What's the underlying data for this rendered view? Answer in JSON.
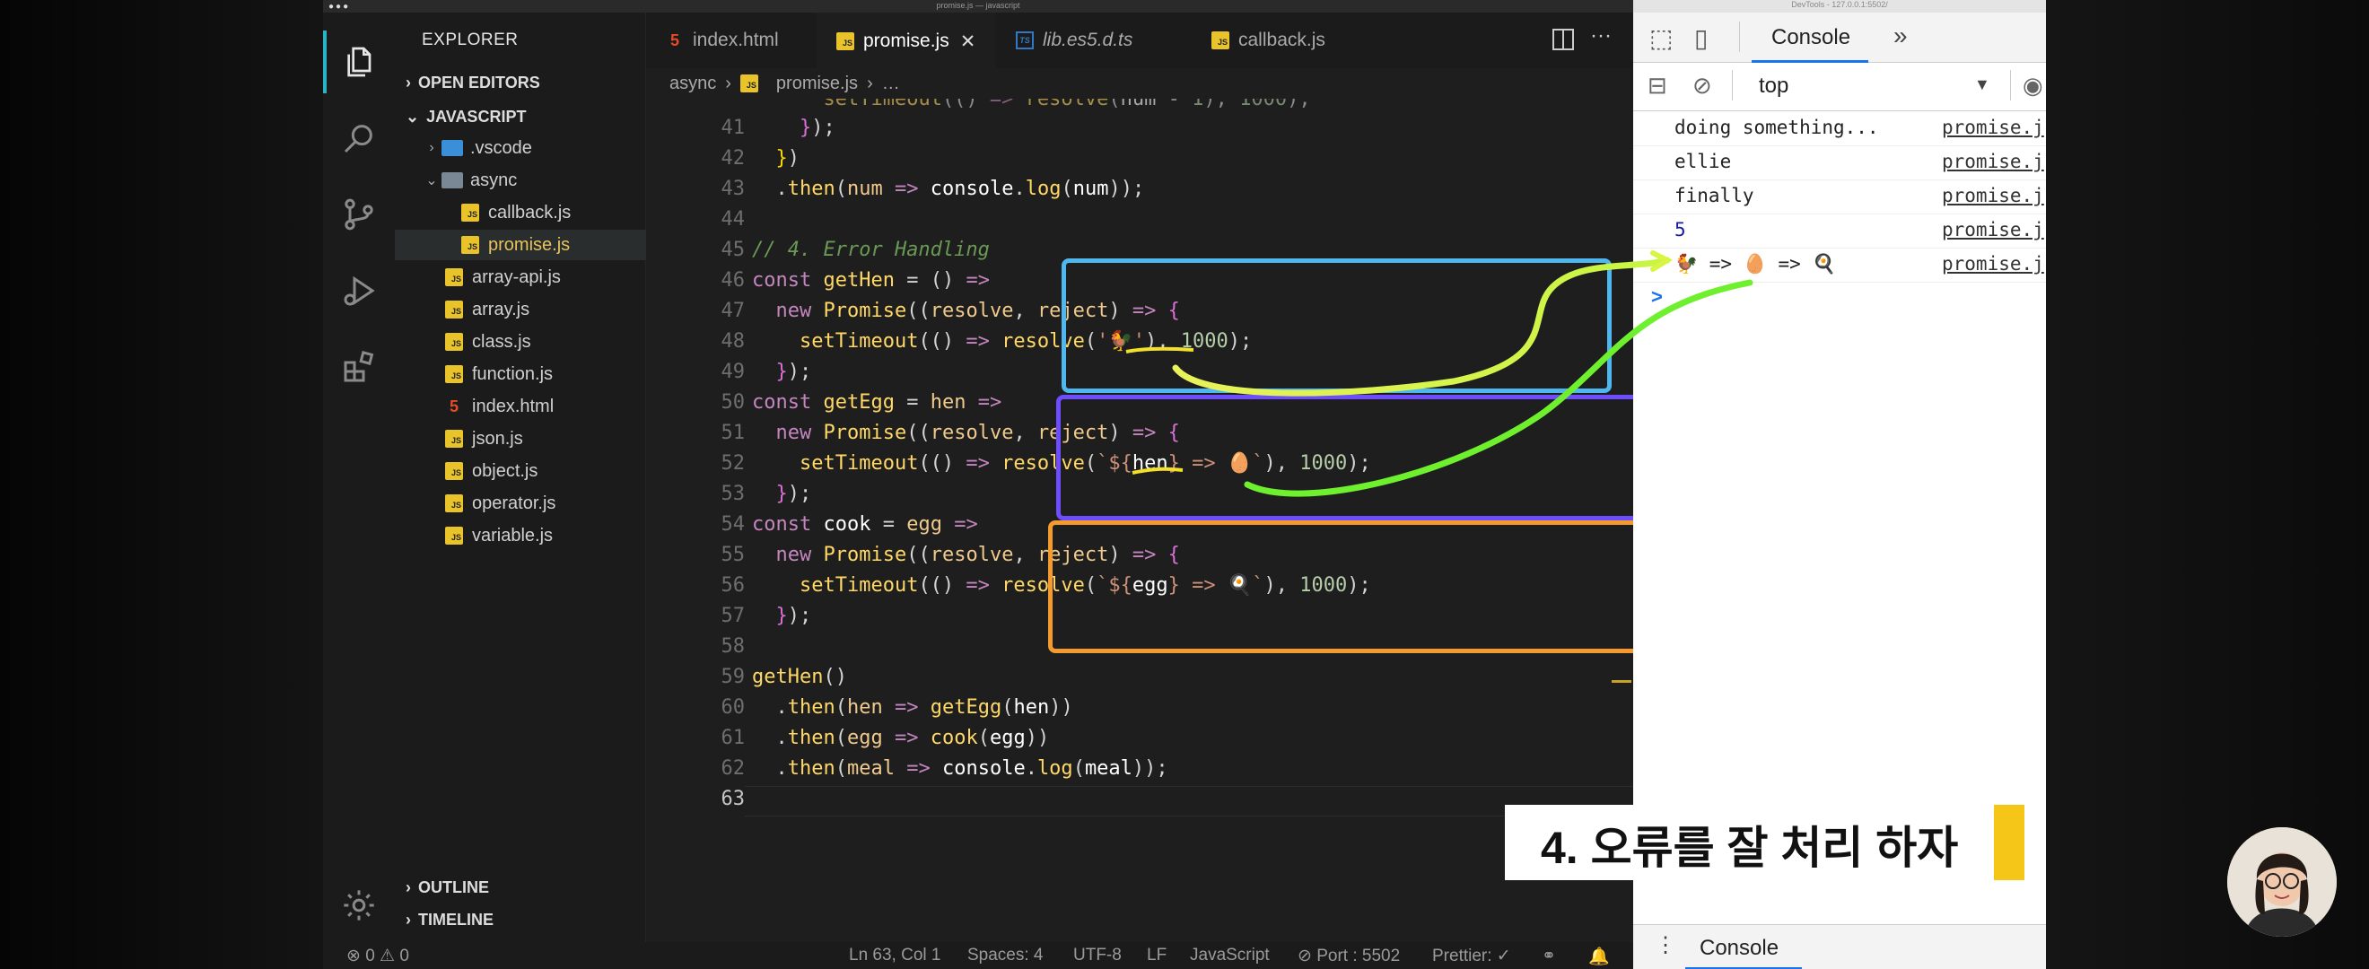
{
  "window": {
    "title": "promise.js — javascript"
  },
  "explorer": {
    "title": "EXPLORER",
    "open_editors": "OPEN EDITORS",
    "root": "JAVASCRIPT",
    "items": [
      {
        "label": ".vscode"
      },
      {
        "label": "async"
      },
      {
        "label": "callback.js"
      },
      {
        "label": "promise.js"
      },
      {
        "label": "array-api.js"
      },
      {
        "label": "array.js"
      },
      {
        "label": "class.js"
      },
      {
        "label": "function.js"
      },
      {
        "label": "index.html"
      },
      {
        "label": "json.js"
      },
      {
        "label": "object.js"
      },
      {
        "label": "operator.js"
      },
      {
        "label": "variable.js"
      }
    ],
    "outline": "OUTLINE",
    "timeline": "TIMELINE"
  },
  "tabs": [
    {
      "label": "index.html"
    },
    {
      "label": "promise.js"
    },
    {
      "label": "lib.es5.d.ts"
    },
    {
      "label": "callback.js"
    }
  ],
  "breadcrumb": {
    "folder": "async",
    "file": "promise.js",
    "more": "…"
  },
  "code": {
    "lines": [
      "41",
      "42",
      "43",
      "44",
      "45",
      "46",
      "47",
      "48",
      "49",
      "50",
      "51",
      "52",
      "53",
      "54",
      "55",
      "56",
      "57",
      "58",
      "59",
      "60",
      "61",
      "62",
      "63"
    ],
    "comment": "// 4. Error Handling"
  },
  "status": {
    "problems": "⊗ 0 ⚠ 0",
    "position": "Ln 63, Col 1",
    "spaces": "Spaces: 4",
    "encoding": "UTF-8",
    "eol": "LF",
    "language": "JavaScript",
    "port": "⊘ Port : 5502",
    "prettier": "Prettier: ✓"
  },
  "devtools": {
    "title": "DevTools - 127.0.0.1:5502/",
    "tab": "Console",
    "context": "top",
    "logs": [
      {
        "msg": "doing something...",
        "src": "promise.j"
      },
      {
        "msg": "ellie",
        "src": "promise.j"
      },
      {
        "msg": "finally",
        "src": "promise.j"
      },
      {
        "msg": "5",
        "src": "promise.j"
      },
      {
        "msg": "🐓 => 🥚 => 🍳",
        "src": "promise.j"
      }
    ],
    "prompt": ">",
    "drawer_tab": "Console"
  },
  "caption": {
    "text": "4. 오류를 잘 처리 하자"
  },
  "colors": {
    "blue_box": "#4fb7f0",
    "purple_box": "#6d4dff",
    "orange_box": "#f59a2c",
    "accent": "#28b4c4"
  }
}
